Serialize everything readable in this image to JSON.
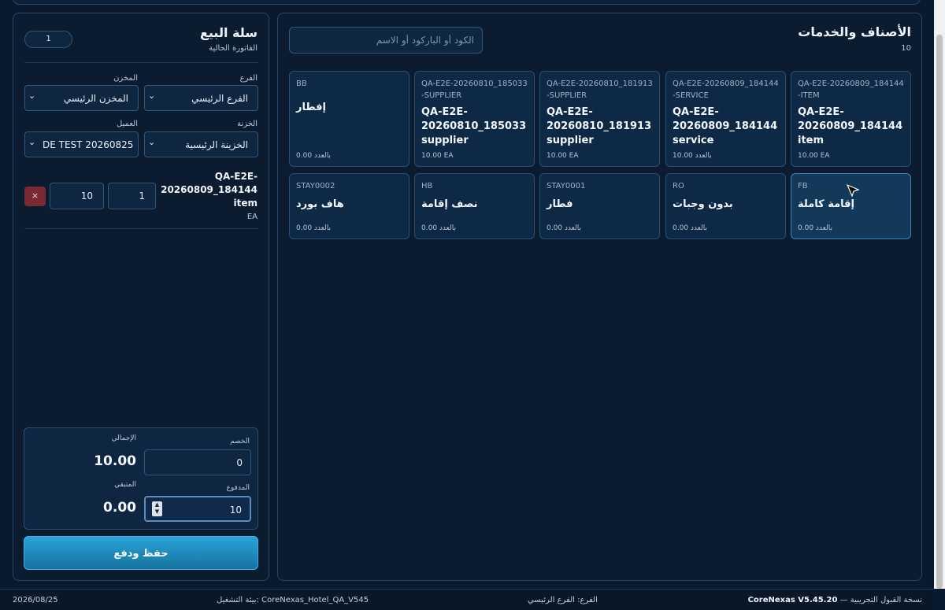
{
  "catalog": {
    "title": "الأصناف والخدمات",
    "count": "10",
    "search_placeholder": "الكود أو الباركود أو الاسم",
    "items": [
      {
        "code": "QA-E2E-20260809_184144-ITEM",
        "name": "QA-E2E-20260809_184144 item",
        "meta": "10.00 EA"
      },
      {
        "code": "QA-E2E-20260809_184144-SERVICE",
        "name": "QA-E2E-20260809_184144 service",
        "meta": "10.00 بالعدد"
      },
      {
        "code": "QA-E2E-20260810_181913-SUPPLIER",
        "name": "QA-E2E-20260810_181913 supplier",
        "meta": "10.00 EA"
      },
      {
        "code": "QA-E2E-20260810_185033-SUPPLIER",
        "name": "QA-E2E-20260810_185033 supplier",
        "meta": "10.00 EA"
      },
      {
        "code": "BB",
        "name": "إفطار",
        "meta": "0.00 بالعدد"
      },
      {
        "code": "FB",
        "name": "إقامة كاملة",
        "meta": "0.00 بالعدد"
      },
      {
        "code": "RO",
        "name": "بدون وجبات",
        "meta": "0.00 بالعدد"
      },
      {
        "code": "STAY0001",
        "name": "فطار",
        "meta": "0.00 بالعدد"
      },
      {
        "code": "HB",
        "name": "نصف إقامة",
        "meta": "0.00 بالعدد"
      },
      {
        "code": "STAY0002",
        "name": "هاف بورد",
        "meta": "0.00 بالعدد"
      }
    ]
  },
  "cart": {
    "title": "سلة البيع",
    "subtitle": "الفاتورة الحالية",
    "invoice_badge": "1",
    "branch_label": "الفرع",
    "branch_value": "الفرع الرئيسي",
    "warehouse_label": "المخزن",
    "warehouse_value": "المخزن الرئيسي",
    "treasury_label": "الخزنة",
    "treasury_value": "الخزينة الرئيسية",
    "customer_label": "العميل",
    "customer_value": "DE TEST 20260825",
    "line": {
      "name": "QA-E2E-20260809_184144 item",
      "unit": "EA",
      "qty": "1",
      "price": "10",
      "remove": "×"
    },
    "totals": {
      "discount_label": "الخصم",
      "discount_value": "0",
      "total_label": "الإجمالي",
      "total_value": "10.00",
      "paid_label": "المدفوع",
      "paid_value": "10",
      "remaining_label": "المتبقي",
      "remaining_value": "0.00"
    },
    "save_label": "حفظ ودفع"
  },
  "footer": {
    "product": "CoreNexas V5.45.20",
    "edition": "— نسخة القبول التجريبية",
    "branch": "الفرع: الفرع الرئيسي",
    "env": "بيئة التشغيل: CoreNexas_Hotel_QA_V545",
    "date": "2026/08/25"
  },
  "colors": {
    "background": "#0a1a2e",
    "panel": "#0b1c31",
    "card": "#0e2945",
    "accent": "#2aa3d8",
    "danger": "#7a2a35"
  }
}
